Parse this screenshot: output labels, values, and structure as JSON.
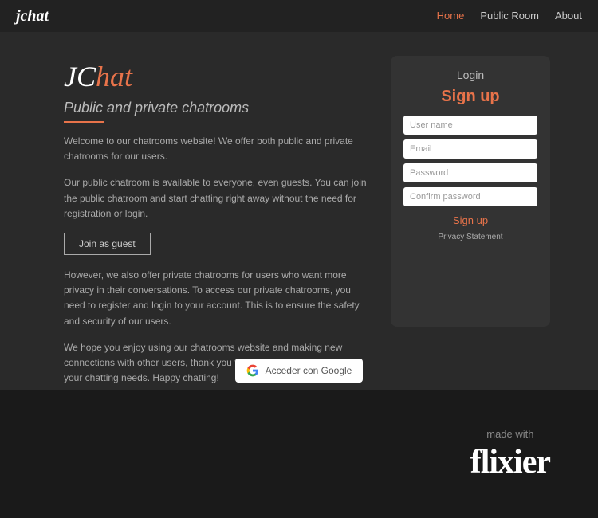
{
  "nav": {
    "logo": "jchat",
    "links": [
      {
        "label": "Home",
        "active": true
      },
      {
        "label": "Public Room",
        "active": false
      },
      {
        "label": "About",
        "active": false
      }
    ]
  },
  "hero": {
    "brand_jc": "JC",
    "brand_hat": "hat",
    "tagline": "Public and private chatrooms",
    "desc1": "Welcome to our chatrooms website! We offer both public and private chatrooms for our users.",
    "desc2": "Our public chatroom is available to everyone, even guests. You can join the public chatroom and start chatting right away without the need for registration or login.",
    "join_label": "Join as guest",
    "desc3": "However, we also offer private chatrooms for users who want more privacy in their conversations. To access our private chatrooms, you need to register and login to your account. This is to ensure the safety and security of our users.",
    "desc4": "We hope you enjoy using our chatrooms website and making new connections with other users, thank you for choosing our website for your chatting needs. Happy chatting!"
  },
  "login_panel": {
    "login_title": "Login",
    "signup_title": "Sign up",
    "username_placeholder": "User name",
    "email_placeholder": "Email",
    "password_placeholder": "Password",
    "confirm_placeholder": "Confirm password",
    "signup_btn": "Sign up",
    "privacy_label": "Privacy Statement"
  },
  "google": {
    "btn_label": "Acceder con Google"
  },
  "footer": {
    "made_with": "made with",
    "brand": "flixier"
  }
}
